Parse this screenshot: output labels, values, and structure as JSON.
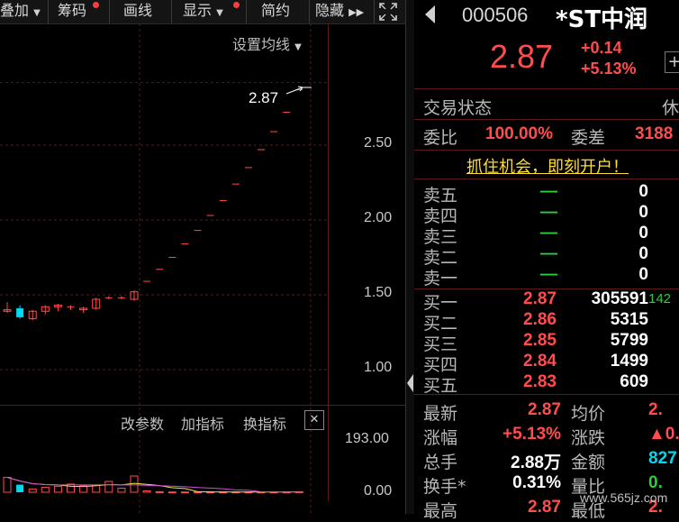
{
  "toolbar": {
    "overlay": "叠加",
    "chips": "筹码",
    "drawline": "画线",
    "display": "显示",
    "simple": "简约",
    "hide": "隐藏"
  },
  "chart": {
    "settings_label": "设置均线",
    "last_price_label": "2.87",
    "y_ticks": [
      "2.50",
      "2.00",
      "1.50",
      "1.00"
    ],
    "volume_ticks": [
      "193.00",
      "0.00"
    ],
    "sub_toolbar": {
      "change_params": "改参数",
      "add_indicator": "加指标",
      "switch_indicator": "换指标",
      "close_symbol": "✕"
    }
  },
  "chart_data": {
    "type": "candlestick",
    "y_range": [
      0.9,
      2.95
    ],
    "candles": [
      {
        "o": 1.39,
        "h": 1.45,
        "l": 1.38,
        "c": 1.4
      },
      {
        "o": 1.41,
        "h": 1.43,
        "l": 1.34,
        "c": 1.35
      },
      {
        "o": 1.34,
        "h": 1.4,
        "l": 1.33,
        "c": 1.39
      },
      {
        "o": 1.39,
        "h": 1.43,
        "l": 1.37,
        "c": 1.42
      },
      {
        "o": 1.42,
        "h": 1.44,
        "l": 1.39,
        "c": 1.43
      },
      {
        "o": 1.42,
        "h": 1.43,
        "l": 1.4,
        "c": 1.42
      },
      {
        "o": 1.4,
        "h": 1.42,
        "l": 1.38,
        "c": 1.41
      },
      {
        "o": 1.41,
        "h": 1.48,
        "l": 1.4,
        "c": 1.47
      },
      {
        "o": 1.48,
        "h": 1.49,
        "l": 1.47,
        "c": 1.48
      },
      {
        "o": 1.48,
        "h": 1.49,
        "l": 1.47,
        "c": 1.48
      },
      {
        "o": 1.47,
        "h": 1.53,
        "l": 1.46,
        "c": 1.52
      },
      {
        "o": 1.59,
        "h": 1.59,
        "l": 1.59,
        "c": 1.59
      },
      {
        "o": 1.67,
        "h": 1.67,
        "l": 1.67,
        "c": 1.67
      },
      {
        "o": 1.75,
        "h": 1.75,
        "l": 1.75,
        "c": 1.75
      },
      {
        "o": 1.84,
        "h": 1.84,
        "l": 1.84,
        "c": 1.84
      },
      {
        "o": 1.93,
        "h": 1.93,
        "l": 1.93,
        "c": 1.93
      },
      {
        "o": 2.03,
        "h": 2.03,
        "l": 2.03,
        "c": 2.03
      },
      {
        "o": 2.13,
        "h": 2.13,
        "l": 2.13,
        "c": 2.13
      },
      {
        "o": 2.24,
        "h": 2.24,
        "l": 2.24,
        "c": 2.24
      },
      {
        "o": 2.35,
        "h": 2.35,
        "l": 2.35,
        "c": 2.35
      },
      {
        "o": 2.47,
        "h": 2.47,
        "l": 2.47,
        "c": 2.47
      },
      {
        "o": 2.59,
        "h": 2.59,
        "l": 2.59,
        "c": 2.59
      },
      {
        "o": 2.72,
        "h": 2.72,
        "l": 2.72,
        "c": 2.72
      },
      {
        "o": 2.87,
        "h": 2.87,
        "l": 2.87,
        "c": 2.87
      }
    ],
    "volume": [
      55,
      28,
      12,
      18,
      22,
      30,
      24,
      26,
      40,
      15,
      60,
      5,
      2,
      1,
      1,
      1,
      1,
      1,
      1,
      1,
      1,
      1,
      1,
      2
    ],
    "volume_range": [
      0,
      193
    ]
  },
  "quote": {
    "code": "000506",
    "name": "*ST中润",
    "price": "2.87",
    "change": "+0.14",
    "change_pct": "+5.13%",
    "plus_symbol": "+",
    "trade_status_label": "交易状态",
    "trade_status_value": "休",
    "wei_bi_label": "委比",
    "wei_bi_value": "100.00%",
    "wei_cha_label": "委差",
    "wei_cha_value": "3188",
    "promo": "抓住机会，即刻开户！"
  },
  "sell": [
    {
      "label": "卖五",
      "price": "—",
      "vol": "0"
    },
    {
      "label": "卖四",
      "price": "—",
      "vol": "0"
    },
    {
      "label": "卖三",
      "price": "—",
      "vol": "0"
    },
    {
      "label": "卖二",
      "price": "—",
      "vol": "0"
    },
    {
      "label": "卖一",
      "price": "—",
      "vol": "0"
    }
  ],
  "buy": [
    {
      "label": "买一",
      "price": "2.87",
      "vol": "305591",
      "extra": "142"
    },
    {
      "label": "买二",
      "price": "2.86",
      "vol": "5315",
      "extra": ""
    },
    {
      "label": "买三",
      "price": "2.85",
      "vol": "5799",
      "extra": ""
    },
    {
      "label": "买四",
      "price": "2.84",
      "vol": "1499",
      "extra": ""
    },
    {
      "label": "买五",
      "price": "2.83",
      "vol": "609",
      "extra": ""
    }
  ],
  "stats": [
    {
      "l1": "最新",
      "v1": "2.87",
      "l2": "均价",
      "v2": "2."
    },
    {
      "l1": "涨幅",
      "v1": "+5.13%",
      "l2": "涨跌",
      "v2": "▲0."
    },
    {
      "l1": "总手",
      "v1": "2.88万",
      "l2": "金额",
      "v2": "827"
    },
    {
      "l1": "换手*",
      "v1": "0.31%",
      "l2": "量比",
      "v2": "0."
    },
    {
      "l1": "最高",
      "v1": "2.87",
      "l2": "最低",
      "v2": "2."
    }
  ],
  "watermark": "www.565jz.com",
  "colors": {
    "up": "#ff4d4d",
    "down": "#00d7f0",
    "flat": "#2ecc40"
  }
}
